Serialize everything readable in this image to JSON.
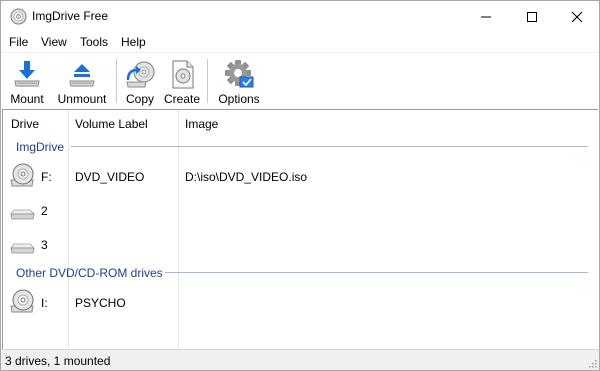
{
  "window": {
    "title": "ImgDrive Free"
  },
  "menu": [
    "File",
    "View",
    "Tools",
    "Help"
  ],
  "toolbar": {
    "mount": "Mount",
    "unmount": "Unmount",
    "copy": "Copy",
    "create": "Create",
    "options": "Options"
  },
  "columns": {
    "drive": "Drive",
    "volume_label": "Volume Label",
    "image": "Image"
  },
  "groups": [
    {
      "label": "ImgDrive",
      "rows": [
        {
          "drive": "F:",
          "volume": "DVD_VIDEO",
          "image": "D:\\iso\\DVD_VIDEO.iso",
          "icon": "disc-drive-loaded-icon"
        },
        {
          "drive": "2",
          "volume": "",
          "image": "",
          "icon": "empty-drive-icon"
        },
        {
          "drive": "3",
          "volume": "",
          "image": "",
          "icon": "empty-drive-icon"
        }
      ]
    },
    {
      "label": "Other DVD/CD-ROM drives",
      "rows": [
        {
          "drive": "I:",
          "volume": "PSYCHO",
          "image": "",
          "icon": "disc-drive-loaded-icon"
        }
      ]
    }
  ],
  "status": {
    "text": "3 drives, 1 mounted"
  },
  "colors": {
    "group_text": "#1f3f8a",
    "group_line": "#a9b8d6",
    "accent_blue": "#1e6fd6"
  }
}
